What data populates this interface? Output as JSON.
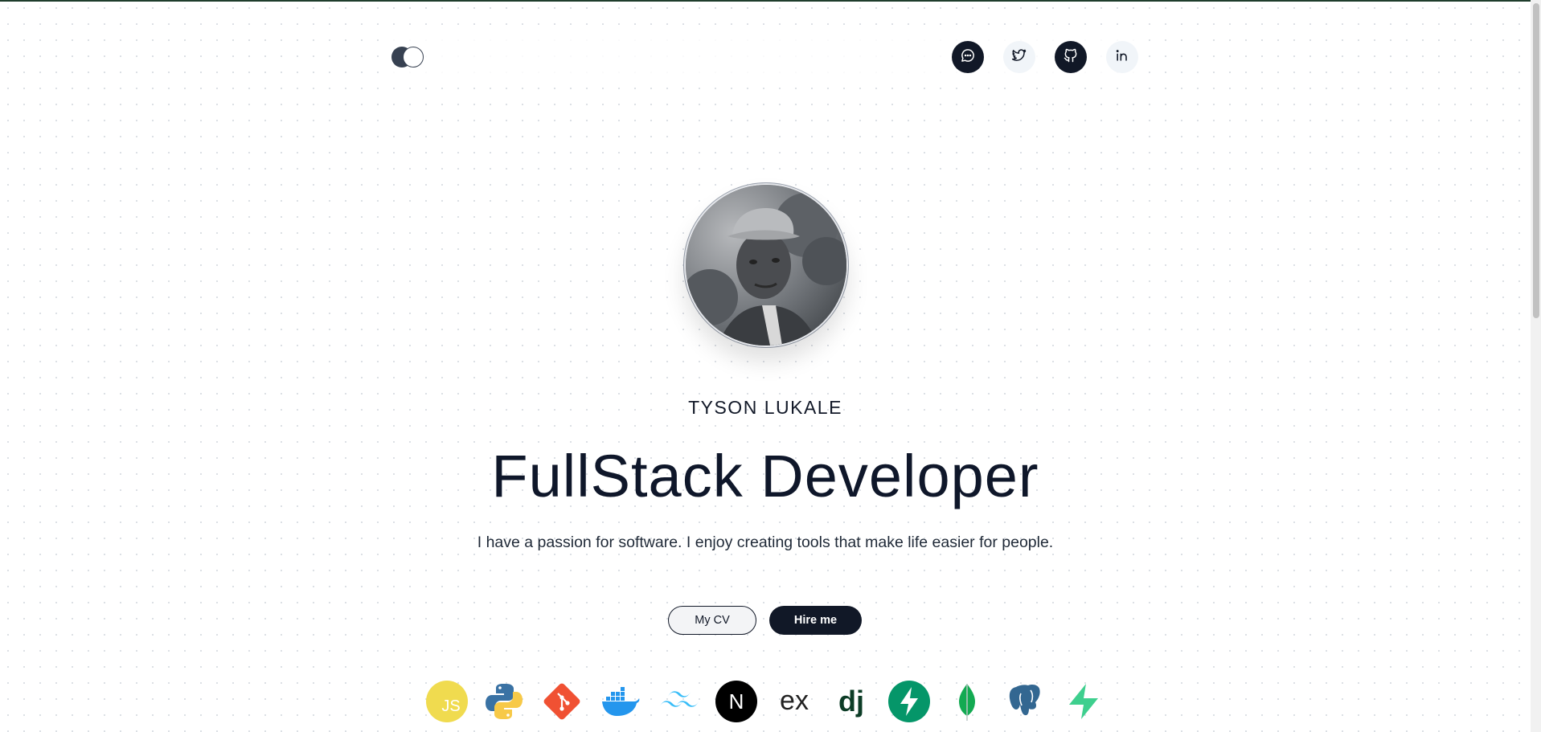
{
  "profile": {
    "name": "TYSON LUKALE",
    "headline": "FullStack Developer",
    "tagline": "I have a passion for software. I enjoy creating tools that make life easier for people."
  },
  "buttons": {
    "cv_label": "My CV",
    "hire_label": "Hire me"
  },
  "social": [
    {
      "icon": "chat-icon",
      "style": "dark"
    },
    {
      "icon": "twitter-icon",
      "style": "light"
    },
    {
      "icon": "github-icon",
      "style": "dark"
    },
    {
      "icon": "linkedin-icon",
      "style": "light"
    }
  ],
  "tech_stack": {
    "icons": [
      "javascript-icon",
      "python-icon",
      "git-icon",
      "docker-icon",
      "tailwind-icon",
      "nextjs-icon",
      "express-icon",
      "django-icon",
      "fastapi-icon",
      "mongodb-icon",
      "postgresql-icon",
      "supabase-icon"
    ],
    "js_text": "JS",
    "next_text": "N",
    "express_text": "ex",
    "django_text": "dj"
  },
  "colors": {
    "primary": "#111827",
    "accent_border": "#1f3d2c",
    "background": "#ffffff"
  }
}
